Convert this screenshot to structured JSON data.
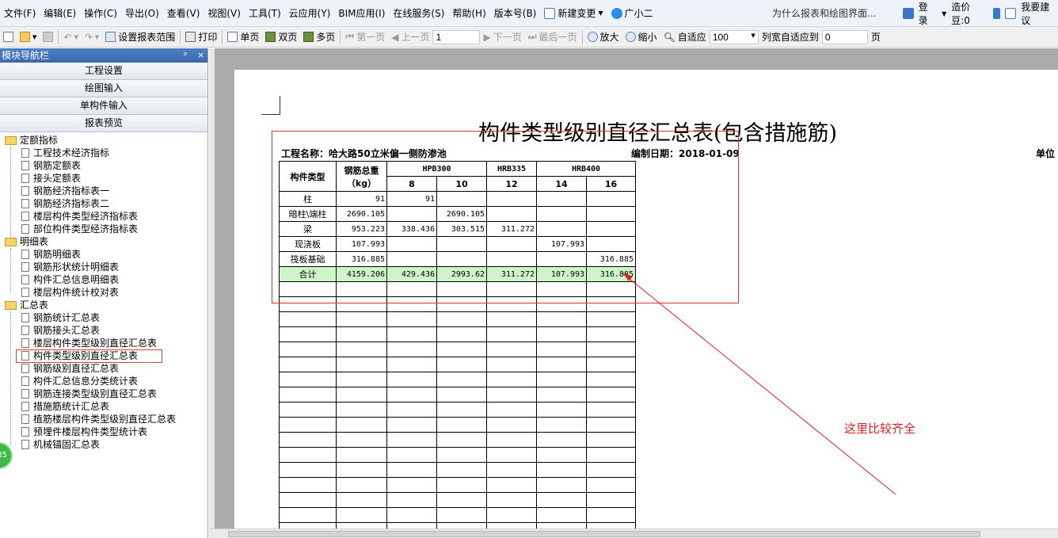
{
  "menubar": {
    "items": [
      "文件(F)",
      "编辑(E)",
      "操作(C)",
      "导出(O)",
      "查看(V)",
      "视图(V)",
      "工具(T)",
      "云应用(Y)",
      "BIM应用(I)",
      "在线服务(S)",
      "帮助(H)",
      "版本号(B)"
    ],
    "new_change": "新建变更",
    "guangxiaoer": "广小二",
    "promo": "为什么报表和绘图界面...",
    "login": "登录",
    "bean_label": "造价豆:0",
    "suggest": "我要建议"
  },
  "toolbar": {
    "set_range": "设置报表范围",
    "print": "打印",
    "single_page": "单页",
    "double_page": "双页",
    "multi_page": "多页",
    "first_page": "第一页",
    "prev_page": "上一页",
    "page_number": "1",
    "next_page": "下一页",
    "last_page": "最后一页",
    "zoom_in": "放大",
    "zoom_out": "缩小",
    "fit": "自适应",
    "zoom_value": "100",
    "col_fit_label": "列宽自适应到",
    "col_fit_value": "0",
    "page_unit": "页"
  },
  "nav": {
    "title": "模块导航栏",
    "pin": "ᵖ",
    "close": "×",
    "buttons": [
      "工程设置",
      "绘图输入",
      "单构件输入",
      "报表预览"
    ],
    "groups": [
      {
        "label": "定额指标",
        "items": [
          "工程技术经济指标",
          "钢筋定额表",
          "接头定额表",
          "钢筋经济指标表一",
          "钢筋经济指标表二",
          "楼层构件类型经济指标表",
          "部位构件类型经济指标表"
        ]
      },
      {
        "label": "明细表",
        "items": [
          "钢筋明细表",
          "钢筋形状统计明细表",
          "构件汇总信息明细表",
          "楼层构件统计校对表"
        ]
      },
      {
        "label": "汇总表",
        "items": [
          "钢筋统计汇总表",
          "钢筋接头汇总表",
          "楼层构件类型级别直径汇总表",
          "构件类型级别直径汇总表",
          "钢筋级别直径汇总表",
          "构件汇总信息分类统计表",
          "钢筋连接类型级别直径汇总表",
          "措施筋统计汇总表",
          "植筋楼层构件类型级别直径汇总表",
          "预埋件楼层构件类型统计表",
          "机械锚固汇总表"
        ]
      }
    ],
    "badge": "85"
  },
  "report": {
    "title": "构件类型级别直径汇总表(包含措施筋)",
    "project": "工程名称：哈大路50立米偏一侧防渗池",
    "date": "编制日期：2018-01-09",
    "unit": "单位",
    "header": {
      "type": "构件类型",
      "total_weight": "钢筋总重（kg）",
      "grades": [
        {
          "name": "HPB300",
          "diameters": [
            "8",
            "10"
          ]
        },
        {
          "name": "HRB335",
          "diameters": [
            "12"
          ]
        },
        {
          "name": "HRB400",
          "diameters": [
            "14",
            "16"
          ]
        }
      ]
    },
    "rows": [
      {
        "type": "柱",
        "total": "91",
        "values": [
          "91",
          "",
          "",
          "",
          ""
        ]
      },
      {
        "type": "暗柱\\端柱",
        "total": "2690.105",
        "values": [
          "",
          "2690.105",
          "",
          "",
          ""
        ]
      },
      {
        "type": "梁",
        "total": "953.223",
        "values": [
          "338.436",
          "303.515",
          "311.272",
          "",
          ""
        ]
      },
      {
        "type": "现浇板",
        "total": "107.993",
        "values": [
          "",
          "",
          "",
          "107.993",
          ""
        ]
      },
      {
        "type": "筏板基础",
        "total": "316.885",
        "values": [
          "",
          "",
          "",
          "",
          "316.885"
        ]
      }
    ],
    "total_row": {
      "type": "合计",
      "total": "4159.206",
      "values": [
        "429.436",
        "2993.62",
        "311.272",
        "107.993",
        "316.885"
      ]
    },
    "annotation": "这里比较齐全"
  }
}
